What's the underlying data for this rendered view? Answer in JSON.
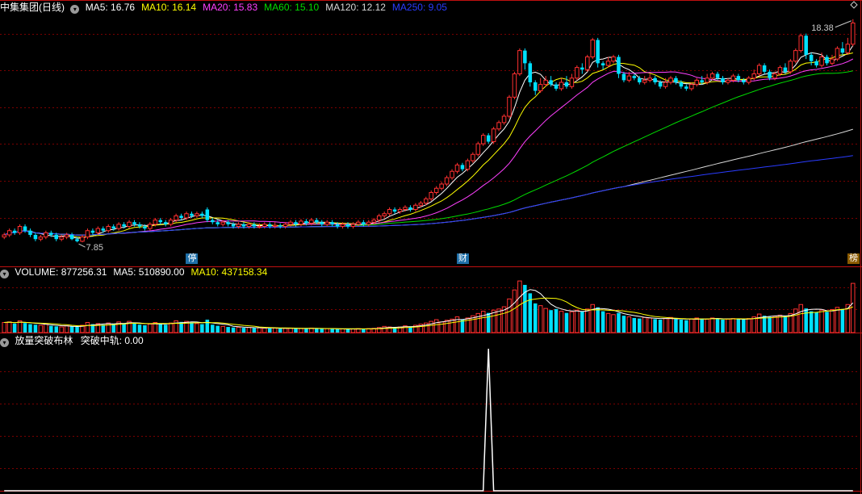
{
  "colors": {
    "background": "#000000",
    "grid": "#7a0000",
    "up": "#ff3030",
    "down": "#00e0ff",
    "ma5": "#ffffff",
    "ma10": "#ffff00",
    "ma20": "#ff40ff",
    "ma60": "#00dd00",
    "ma120": "#d8d8d8",
    "ma250": "#2a3cff",
    "indicator": "#ffffff"
  },
  "header": {
    "stock_name": "中集集团(日线)",
    "toggle_icon": "chevron-down-icon",
    "ma_items": [
      {
        "label": "MA5: 16.76",
        "color": "#ffffff"
      },
      {
        "label": "MA10: 16.14",
        "color": "#ffff00"
      },
      {
        "label": "MA20: 15.83",
        "color": "#ff40ff"
      },
      {
        "label": "MA60: 15.10",
        "color": "#00dd00"
      },
      {
        "label": "MA120: 12.12",
        "color": "#d8d8d8"
      },
      {
        "label": "MA250: 9.05",
        "color": "#2a3cff"
      }
    ]
  },
  "volume_header": {
    "items": [
      {
        "label": "VOLUME: 877256.31",
        "color": "#ffffff"
      },
      {
        "label": "MA5: 510890.00",
        "color": "#ffffff"
      },
      {
        "label": "MA10: 437158.34",
        "color": "#ffff00"
      }
    ]
  },
  "indicator_header": {
    "name": "放量突破布林",
    "value_label": "突破中轨: 0.00"
  },
  "annotations": {
    "high_label": "18.38",
    "low_label": "7.85",
    "markers": [
      {
        "text": "停",
        "bar": 36,
        "bg": "#1e6fa8"
      },
      {
        "text": "财",
        "bar": 88,
        "bg": "#1e6fa8"
      },
      {
        "text": "榜",
        "bar": 168,
        "bg": "#8a5a00"
      }
    ]
  },
  "chart_data": {
    "type": "candlestick",
    "price_ylim": [
      7.4,
      18.6
    ],
    "volume_ylim": [
      0,
      950000
    ],
    "indicator_ylim": [
      0,
      1
    ],
    "candles": [
      [
        8.1,
        8.2,
        8.3,
        8.0
      ],
      [
        8.2,
        8.4,
        8.5,
        8.1
      ],
      [
        8.4,
        8.3,
        8.5,
        8.2
      ],
      [
        8.3,
        8.6,
        8.7,
        8.2
      ],
      [
        8.6,
        8.4,
        8.7,
        8.3
      ],
      [
        8.4,
        8.2,
        8.5,
        8.1
      ],
      [
        8.2,
        8.0,
        8.3,
        7.9
      ],
      [
        8.0,
        8.1,
        8.2,
        7.9
      ],
      [
        8.1,
        8.3,
        8.4,
        8.0
      ],
      [
        8.3,
        8.2,
        8.4,
        8.1
      ],
      [
        8.2,
        8.0,
        8.3,
        7.9
      ],
      [
        8.0,
        8.1,
        8.2,
        7.9
      ],
      [
        8.1,
        8.2,
        8.3,
        8.0
      ],
      [
        8.2,
        8.0,
        8.3,
        7.95
      ],
      [
        8.0,
        7.9,
        8.1,
        7.85
      ],
      [
        7.9,
        8.1,
        8.2,
        7.85
      ],
      [
        8.1,
        8.4,
        8.5,
        8.0
      ],
      [
        8.4,
        8.3,
        8.5,
        8.2
      ],
      [
        8.3,
        8.5,
        8.6,
        8.2
      ],
      [
        8.5,
        8.4,
        8.6,
        8.3
      ],
      [
        8.4,
        8.6,
        8.7,
        8.3
      ],
      [
        8.6,
        8.5,
        8.7,
        8.4
      ],
      [
        8.5,
        8.7,
        8.8,
        8.4
      ],
      [
        8.7,
        8.6,
        8.8,
        8.5
      ],
      [
        8.6,
        8.8,
        8.9,
        8.5
      ],
      [
        8.8,
        8.7,
        8.9,
        8.6
      ],
      [
        8.7,
        8.6,
        8.8,
        8.5
      ],
      [
        8.6,
        8.5,
        8.7,
        8.4
      ],
      [
        8.5,
        8.7,
        8.8,
        8.4
      ],
      [
        8.7,
        8.9,
        9.0,
        8.6
      ],
      [
        8.9,
        8.8,
        9.0,
        8.7
      ],
      [
        8.8,
        8.7,
        8.9,
        8.6
      ],
      [
        8.7,
        8.9,
        9.0,
        8.6
      ],
      [
        8.9,
        9.1,
        9.2,
        8.8
      ],
      [
        9.1,
        9.0,
        9.2,
        8.9
      ],
      [
        9.0,
        9.2,
        9.3,
        8.9
      ],
      [
        9.2,
        9.1,
        9.3,
        9.0
      ],
      [
        9.1,
        9.2,
        9.3,
        9.0
      ],
      [
        9.2,
        9.1,
        9.3,
        9.0
      ],
      [
        9.4,
        8.9,
        9.5,
        8.8
      ],
      [
        8.9,
        8.8,
        9.0,
        8.7
      ],
      [
        8.8,
        8.7,
        8.9,
        8.6
      ],
      [
        8.7,
        8.8,
        8.9,
        8.6
      ],
      [
        8.8,
        8.7,
        8.9,
        8.6
      ],
      [
        8.7,
        8.6,
        8.8,
        8.5
      ],
      [
        8.6,
        8.7,
        8.8,
        8.5
      ],
      [
        8.7,
        8.6,
        8.8,
        8.5
      ],
      [
        8.6,
        8.7,
        8.8,
        8.5
      ],
      [
        8.7,
        8.6,
        8.8,
        8.5
      ],
      [
        8.6,
        8.6,
        8.75,
        8.5
      ],
      [
        8.6,
        8.7,
        8.8,
        8.5
      ],
      [
        8.7,
        8.6,
        8.8,
        8.5
      ],
      [
        8.6,
        8.65,
        8.8,
        8.5
      ],
      [
        8.65,
        8.6,
        8.75,
        8.5
      ],
      [
        8.6,
        8.7,
        8.8,
        8.5
      ],
      [
        8.7,
        8.8,
        8.9,
        8.6
      ],
      [
        8.8,
        8.7,
        8.9,
        8.6
      ],
      [
        8.7,
        8.85,
        8.95,
        8.6
      ],
      [
        8.85,
        8.75,
        8.95,
        8.65
      ],
      [
        8.75,
        8.9,
        9.0,
        8.65
      ],
      [
        8.9,
        8.8,
        9.0,
        8.7
      ],
      [
        8.8,
        8.7,
        8.9,
        8.6
      ],
      [
        8.7,
        8.8,
        8.9,
        8.6
      ],
      [
        8.8,
        8.7,
        8.9,
        8.6
      ],
      [
        8.7,
        8.6,
        8.8,
        8.5
      ],
      [
        8.6,
        8.7,
        8.8,
        8.5
      ],
      [
        8.7,
        8.6,
        8.8,
        8.5
      ],
      [
        8.6,
        8.7,
        8.8,
        8.5
      ],
      [
        8.7,
        8.8,
        8.9,
        8.6
      ],
      [
        8.8,
        8.7,
        8.9,
        8.6
      ],
      [
        8.7,
        8.8,
        8.9,
        8.6
      ],
      [
        8.8,
        8.9,
        9.0,
        8.7
      ],
      [
        8.9,
        9.1,
        9.2,
        8.8
      ],
      [
        9.1,
        9.2,
        9.3,
        9.0
      ],
      [
        9.2,
        9.4,
        9.5,
        9.1
      ],
      [
        9.4,
        9.3,
        9.5,
        9.2
      ],
      [
        9.3,
        9.4,
        9.5,
        9.2
      ],
      [
        9.4,
        9.5,
        9.6,
        9.3
      ],
      [
        9.5,
        9.4,
        9.6,
        9.3
      ],
      [
        9.4,
        9.6,
        9.7,
        9.3
      ],
      [
        9.6,
        9.7,
        9.8,
        9.5
      ],
      [
        9.7,
        9.9,
        10.0,
        9.6
      ],
      [
        9.9,
        10.2,
        10.3,
        9.8
      ],
      [
        10.2,
        10.4,
        10.5,
        10.1
      ],
      [
        10.4,
        10.6,
        10.7,
        10.3
      ],
      [
        10.6,
        10.9,
        11.0,
        10.5
      ],
      [
        10.9,
        11.2,
        11.3,
        10.8
      ],
      [
        11.2,
        11.5,
        11.6,
        11.1
      ],
      [
        11.5,
        11.3,
        11.6,
        11.2
      ],
      [
        11.3,
        11.7,
        11.8,
        11.2
      ],
      [
        11.7,
        12.0,
        12.1,
        11.6
      ],
      [
        12.0,
        12.5,
        12.6,
        11.9
      ],
      [
        12.5,
        12.9,
        13.0,
        12.4
      ],
      [
        12.9,
        12.6,
        13.0,
        12.5
      ],
      [
        12.6,
        13.2,
        13.3,
        12.5
      ],
      [
        13.2,
        13.5,
        13.6,
        13.1
      ],
      [
        13.5,
        13.8,
        13.9,
        13.4
      ],
      [
        13.8,
        14.7,
        14.8,
        13.7
      ],
      [
        14.7,
        15.8,
        15.9,
        14.6
      ],
      [
        15.8,
        16.9,
        17.0,
        15.7
      ],
      [
        16.9,
        16.3,
        17.0,
        16.0
      ],
      [
        16.3,
        15.4,
        16.4,
        15.2
      ],
      [
        15.4,
        15.0,
        15.5,
        14.8
      ],
      [
        15.0,
        15.3,
        15.6,
        14.9
      ],
      [
        15.3,
        15.5,
        15.7,
        15.2
      ],
      [
        15.5,
        15.3,
        15.7,
        15.2
      ],
      [
        15.3,
        15.1,
        15.4,
        15.0
      ],
      [
        15.1,
        15.4,
        15.6,
        15.0
      ],
      [
        15.4,
        15.2,
        15.7,
        15.1
      ],
      [
        15.2,
        15.6,
        15.8,
        15.1
      ],
      [
        15.6,
        16.1,
        16.2,
        15.5
      ],
      [
        16.1,
        16.0,
        16.3,
        15.8
      ],
      [
        16.0,
        16.6,
        16.7,
        15.9
      ],
      [
        16.6,
        17.4,
        17.5,
        16.5
      ],
      [
        17.4,
        16.3,
        17.5,
        16.1
      ],
      [
        16.3,
        16.2,
        16.4,
        16.0
      ],
      [
        16.2,
        16.4,
        16.6,
        16.1
      ],
      [
        16.4,
        16.6,
        16.7,
        16.3
      ],
      [
        16.6,
        15.8,
        16.7,
        15.6
      ],
      [
        15.8,
        15.5,
        15.9,
        15.4
      ],
      [
        15.5,
        15.7,
        15.9,
        15.4
      ],
      [
        15.7,
        15.6,
        15.8,
        15.5
      ],
      [
        15.6,
        15.4,
        15.7,
        15.3
      ],
      [
        15.4,
        15.5,
        15.7,
        15.3
      ],
      [
        15.5,
        15.6,
        15.8,
        15.4
      ],
      [
        15.6,
        15.4,
        15.7,
        15.3
      ],
      [
        15.4,
        15.2,
        15.5,
        15.1
      ],
      [
        15.2,
        15.4,
        15.6,
        15.1
      ],
      [
        15.4,
        15.6,
        15.7,
        15.3
      ],
      [
        15.6,
        15.4,
        15.7,
        15.3
      ],
      [
        15.4,
        15.2,
        15.5,
        15.1
      ],
      [
        15.2,
        15.1,
        15.3,
        15.0
      ],
      [
        15.1,
        15.3,
        15.4,
        15.0
      ],
      [
        15.3,
        15.5,
        15.6,
        15.2
      ],
      [
        15.5,
        15.4,
        15.7,
        15.3
      ],
      [
        15.4,
        15.6,
        15.8,
        15.3
      ],
      [
        15.6,
        15.8,
        15.9,
        15.5
      ],
      [
        15.8,
        15.6,
        15.9,
        15.5
      ],
      [
        15.6,
        15.4,
        15.7,
        15.3
      ],
      [
        15.4,
        15.5,
        15.6,
        15.3
      ],
      [
        15.5,
        15.7,
        15.8,
        15.4
      ],
      [
        15.7,
        15.5,
        15.8,
        15.4
      ],
      [
        15.5,
        15.4,
        15.6,
        15.3
      ],
      [
        15.4,
        15.6,
        15.7,
        15.3
      ],
      [
        15.6,
        15.8,
        16.0,
        15.5
      ],
      [
        15.8,
        16.2,
        16.3,
        15.7
      ],
      [
        16.2,
        15.9,
        16.3,
        15.8
      ],
      [
        15.9,
        15.6,
        16.0,
        15.5
      ],
      [
        15.6,
        15.8,
        15.9,
        15.5
      ],
      [
        15.8,
        16.1,
        16.2,
        15.7
      ],
      [
        16.1,
        15.9,
        16.3,
        15.8
      ],
      [
        15.9,
        16.4,
        16.5,
        15.8
      ],
      [
        16.4,
        16.9,
        17.0,
        16.3
      ],
      [
        16.9,
        17.6,
        17.7,
        16.8
      ],
      [
        17.6,
        16.7,
        17.7,
        16.5
      ],
      [
        16.7,
        16.4,
        16.8,
        16.2
      ],
      [
        16.4,
        16.2,
        16.5,
        16.1
      ],
      [
        16.2,
        16.6,
        16.8,
        16.1
      ],
      [
        16.6,
        16.3,
        16.7,
        16.2
      ],
      [
        16.3,
        16.5,
        16.7,
        16.2
      ],
      [
        16.5,
        17.0,
        17.1,
        16.4
      ],
      [
        17.0,
        16.8,
        17.3,
        16.7
      ],
      [
        16.8,
        17.2,
        17.5,
        16.7
      ],
      [
        17.2,
        18.2,
        18.38,
        17.1
      ]
    ],
    "volumes": [
      180000,
      190000,
      160000,
      210000,
      170000,
      150000,
      140000,
      130000,
      150000,
      120000,
      110000,
      100000,
      120000,
      110000,
      100000,
      130000,
      180000,
      150000,
      160000,
      140000,
      170000,
      150000,
      190000,
      160000,
      200000,
      170000,
      140000,
      130000,
      150000,
      180000,
      160000,
      140000,
      170000,
      210000,
      190000,
      200000,
      180000,
      160000,
      150000,
      230000,
      140000,
      120000,
      110000,
      100000,
      90000,
      95000,
      85000,
      90000,
      80000,
      85000,
      80000,
      75000,
      80000,
      70000,
      75000,
      80000,
      70000,
      75000,
      70000,
      80000,
      70000,
      65000,
      70000,
      65000,
      60000,
      65000,
      60000,
      65000,
      70000,
      65000,
      70000,
      75000,
      90000,
      110000,
      100000,
      90000,
      100000,
      120000,
      110000,
      130000,
      150000,
      170000,
      200000,
      230000,
      190000,
      220000,
      240000,
      280000,
      230000,
      260000,
      300000,
      340000,
      380000,
      350000,
      400000,
      420000,
      460000,
      600000,
      760000,
      920000,
      850000,
      700000,
      520000,
      480000,
      430000,
      400000,
      420000,
      380000,
      350000,
      370000,
      400000,
      380000,
      420000,
      500000,
      450000,
      380000,
      340000,
      320000,
      350000,
      300000,
      280000,
      260000,
      250000,
      270000,
      260000,
      240000,
      230000,
      250000,
      270000,
      240000,
      230000,
      220000,
      240000,
      260000,
      250000,
      240000,
      260000,
      250000,
      230000,
      240000,
      250000,
      240000,
      230000,
      250000,
      280000,
      330000,
      300000,
      280000,
      290000,
      310000,
      300000,
      340000,
      420000,
      500000,
      430000,
      380000,
      360000,
      400000,
      370000,
      410000,
      450000,
      420000,
      500000,
      877256
    ],
    "indicator_values_nonzero": [
      {
        "bar": 93,
        "value": 1
      }
    ]
  }
}
